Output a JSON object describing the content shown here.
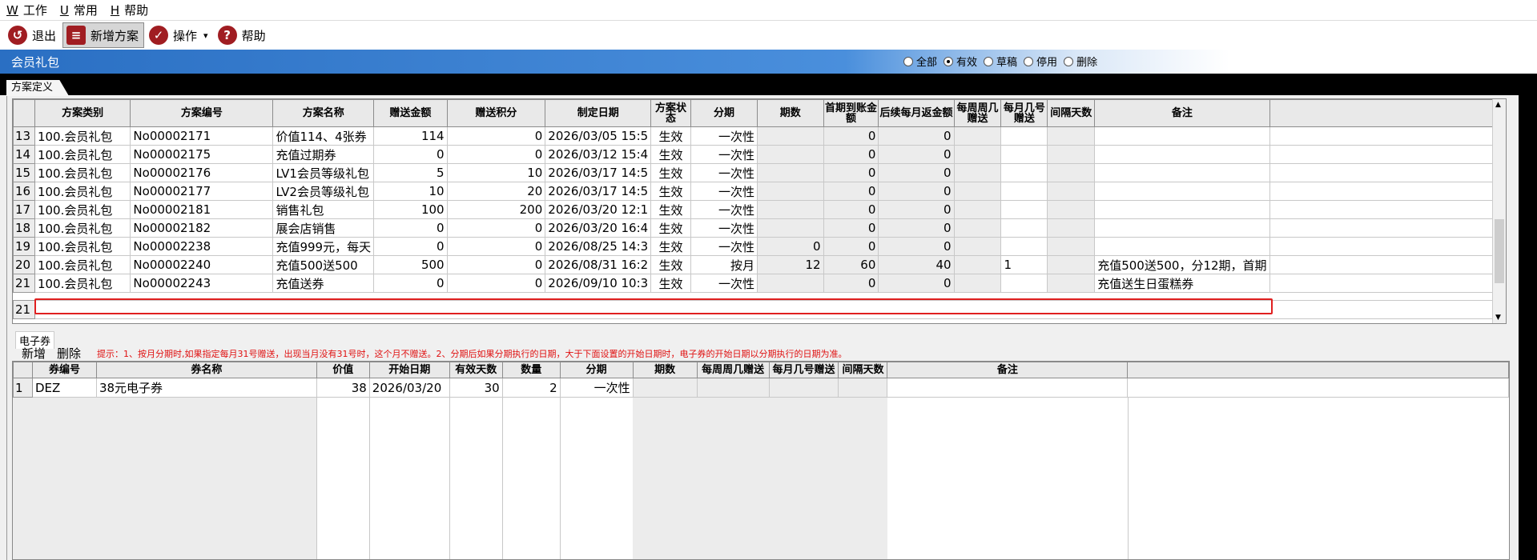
{
  "menubar": {
    "items": [
      {
        "key": "W",
        "label": "工作"
      },
      {
        "key": "U",
        "label": "常用"
      },
      {
        "key": "H",
        "label": "帮助"
      }
    ]
  },
  "toolbar": {
    "exit_label": "退出",
    "new_plan_label": "新增方案",
    "operate_label": "操作",
    "help_label": "帮助"
  },
  "header": {
    "title": "会员礼包",
    "filters": [
      {
        "label": "全部",
        "selected": false
      },
      {
        "label": "有效",
        "selected": true
      },
      {
        "label": "草稿",
        "selected": false
      },
      {
        "label": "停用",
        "selected": false
      },
      {
        "label": "删除",
        "selected": false
      }
    ]
  },
  "tab": {
    "label": "方案定义"
  },
  "plan_grid": {
    "columns": [
      "方案类别",
      "方案编号",
      "方案名称",
      "赠送金额",
      "赠送积分",
      "制定日期",
      "方案状态",
      "分期",
      "期数",
      "首期到账金额",
      "后续每月返金额",
      "每周周几赠送",
      "每月几号赠送",
      "间隔天数",
      "备注"
    ],
    "rows": [
      {
        "no": "13",
        "cat": "100.会员礼包",
        "code": "No00002171",
        "name": "价值114、4张券",
        "amount": "114",
        "points": "0",
        "date": "2026/03/05 15:5",
        "status": "生效",
        "period": "一次性",
        "count": "",
        "first": "0",
        "monthly": "0",
        "weekday": "",
        "monthday": "",
        "interval": "",
        "remark": ""
      },
      {
        "no": "14",
        "cat": "100.会员礼包",
        "code": "No00002175",
        "name": "充值过期券",
        "amount": "0",
        "points": "0",
        "date": "2026/03/12 15:4",
        "status": "生效",
        "period": "一次性",
        "count": "",
        "first": "0",
        "monthly": "0",
        "weekday": "",
        "monthday": "",
        "interval": "",
        "remark": ""
      },
      {
        "no": "15",
        "cat": "100.会员礼包",
        "code": "No00002176",
        "name": "LV1会员等级礼包",
        "amount": "5",
        "points": "10",
        "date": "2026/03/17 14:5",
        "status": "生效",
        "period": "一次性",
        "count": "",
        "first": "0",
        "monthly": "0",
        "weekday": "",
        "monthday": "",
        "interval": "",
        "remark": ""
      },
      {
        "no": "16",
        "cat": "100.会员礼包",
        "code": "No00002177",
        "name": "LV2会员等级礼包",
        "amount": "10",
        "points": "20",
        "date": "2026/03/17 14:5",
        "status": "生效",
        "period": "一次性",
        "count": "",
        "first": "0",
        "monthly": "0",
        "weekday": "",
        "monthday": "",
        "interval": "",
        "remark": ""
      },
      {
        "no": "17",
        "cat": "100.会员礼包",
        "code": "No00002181",
        "name": "销售礼包",
        "amount": "100",
        "points": "200",
        "date": "2026/03/20 12:1",
        "status": "生效",
        "period": "一次性",
        "count": "",
        "first": "0",
        "monthly": "0",
        "weekday": "",
        "monthday": "",
        "interval": "",
        "remark": ""
      },
      {
        "no": "18",
        "cat": "100.会员礼包",
        "code": "No00002182",
        "name": "展会店销售",
        "amount": "0",
        "points": "0",
        "date": "2026/03/20 16:4",
        "status": "生效",
        "period": "一次性",
        "count": "",
        "first": "0",
        "monthly": "0",
        "weekday": "",
        "monthday": "",
        "interval": "",
        "remark": ""
      },
      {
        "no": "19",
        "cat": "100.会员礼包",
        "code": "No00002238",
        "name": "充值999元，每天",
        "amount": "0",
        "points": "0",
        "date": "2026/08/25 14:3",
        "status": "生效",
        "period": "一次性",
        "count": "0",
        "first": "0",
        "monthly": "0",
        "weekday": "",
        "monthday": "",
        "interval": "",
        "remark": ""
      },
      {
        "no": "20",
        "cat": "100.会员礼包",
        "code": "No00002240",
        "name": "充值500送500",
        "amount": "500",
        "points": "0",
        "date": "2026/08/31 16:2",
        "status": "生效",
        "period": "按月",
        "count": "12",
        "first": "60",
        "monthly": "40",
        "weekday": "",
        "monthday": "1",
        "interval": "",
        "remark": "充值500送500，分12期，首期"
      },
      {
        "no": "21",
        "cat": "100.会员礼包",
        "code": "No00002243",
        "name": "充值送券",
        "amount": "0",
        "points": "0",
        "date": "2026/09/10 10:3",
        "status": "生效",
        "period": "一次性",
        "count": "",
        "first": "0",
        "monthly": "0",
        "weekday": "",
        "monthday": "",
        "interval": "",
        "remark": "充值送生日蛋糕券"
      }
    ],
    "footer_count": "21"
  },
  "coupon": {
    "tab_label": "电子券",
    "add_label": "新增",
    "delete_label": "删除",
    "hint": "提示：1、按月分期时,如果指定每月31号赠送，出现当月没有31号时，这个月不赠送。2、分期后如果分期执行的日期，大于下面设置的开始日期时，电子券的开始日期以分期执行的日期为准。",
    "columns": [
      "券编号",
      "券名称",
      "价值",
      "开始日期",
      "有效天数",
      "数量",
      "分期",
      "期数",
      "每周周几赠送",
      "每月几号赠送",
      "间隔天数",
      "备注"
    ],
    "rows": [
      {
        "no": "1",
        "code": "DEZ",
        "name": "38元电子券",
        "value": "38",
        "start": "2026/03/20",
        "days": "30",
        "qty": "2",
        "period": "一次性",
        "count": "",
        "weekday": "",
        "monthday": "",
        "interval": "",
        "remark": ""
      }
    ]
  },
  "colors": {
    "accent": "#2a6fc3",
    "highlight": "#e02020",
    "hint": "#e01010"
  }
}
